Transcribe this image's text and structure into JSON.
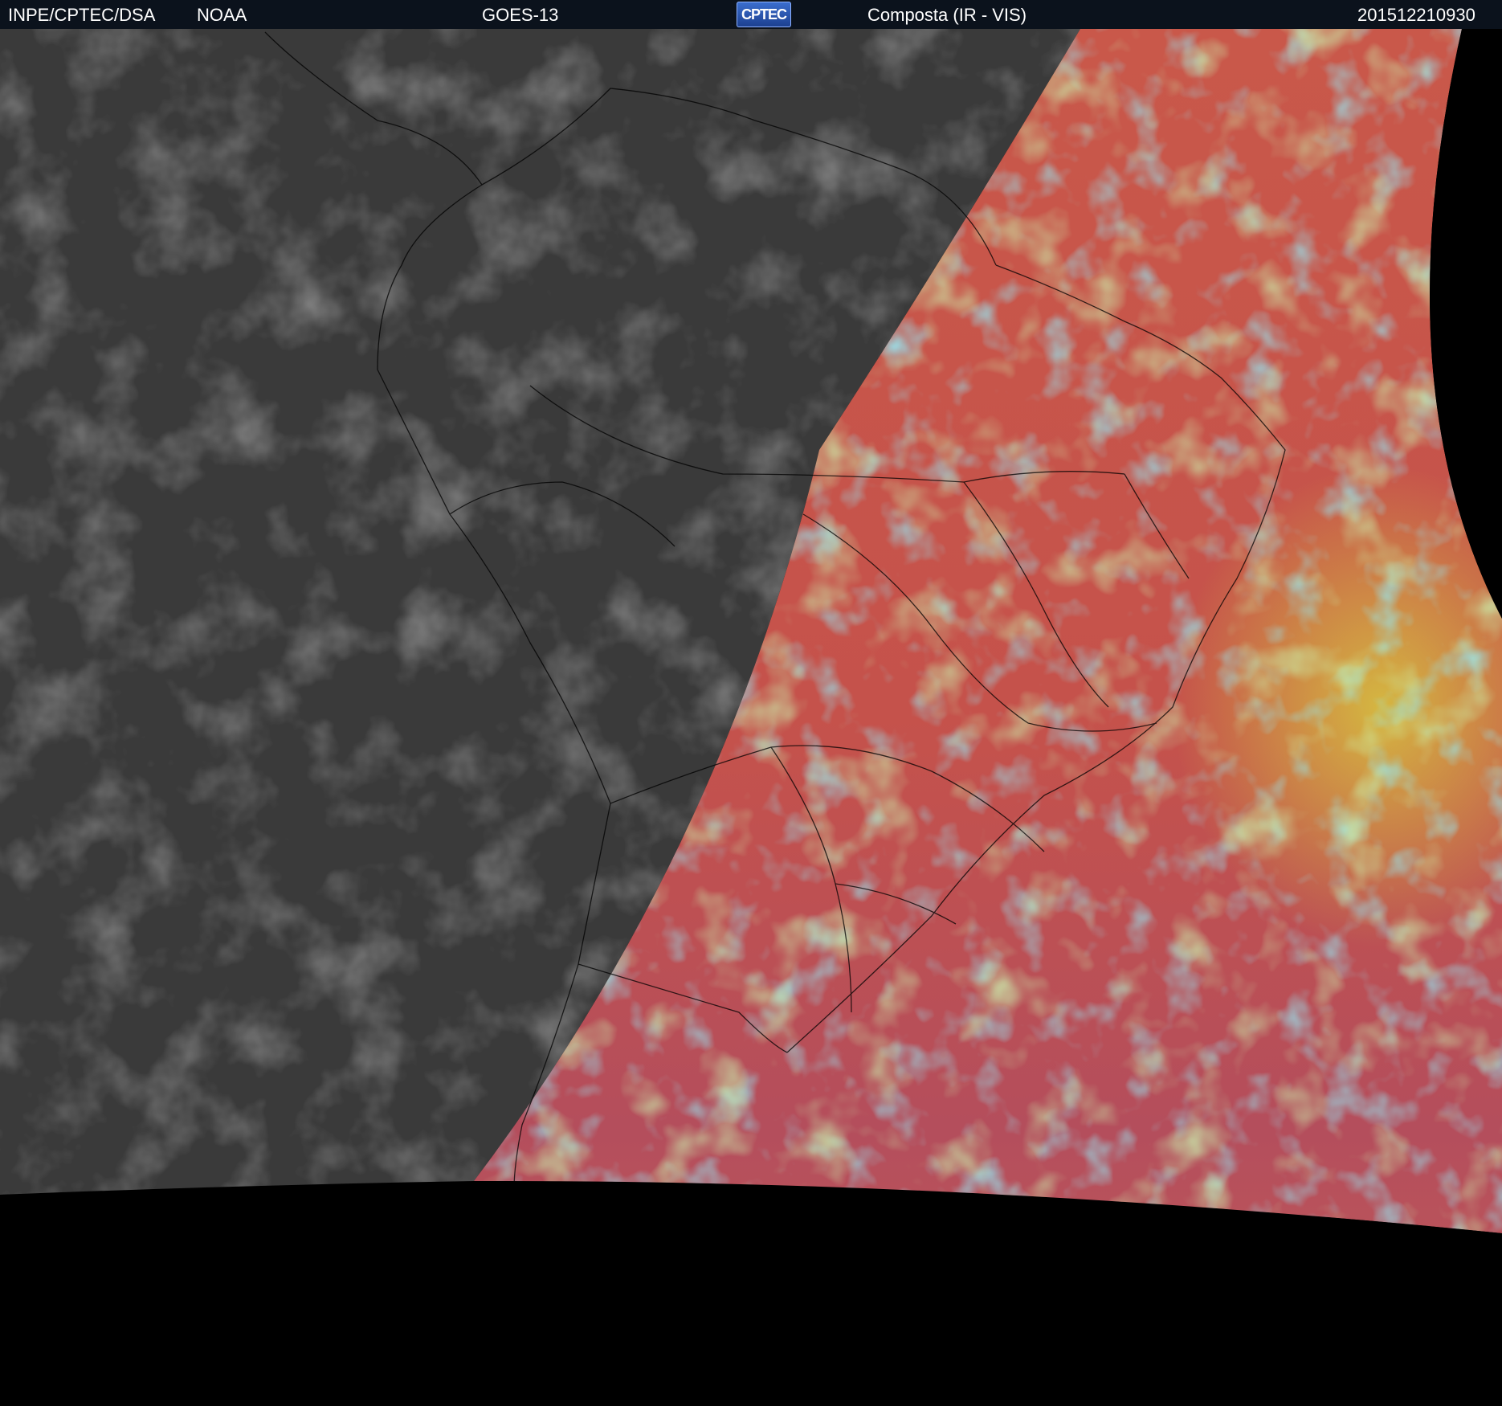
{
  "header": {
    "org": "INPE/CPTEC/DSA",
    "agency": "NOAA",
    "satellite": "GOES-13",
    "logo_text": "CPTEC",
    "product": "Composta (IR - VIS)",
    "timestamp": "201512210930"
  },
  "colors": {
    "header_bg": "#0b121c",
    "ir_gray": "#3a3a3a",
    "vis_red": "#c4544a",
    "vis_cyan": "#3cc0e8",
    "vis_green": "#8ce07a",
    "vis_orange": "#d8a040",
    "background": "#000000"
  },
  "icons": [
    "cptec-logo-icon"
  ]
}
